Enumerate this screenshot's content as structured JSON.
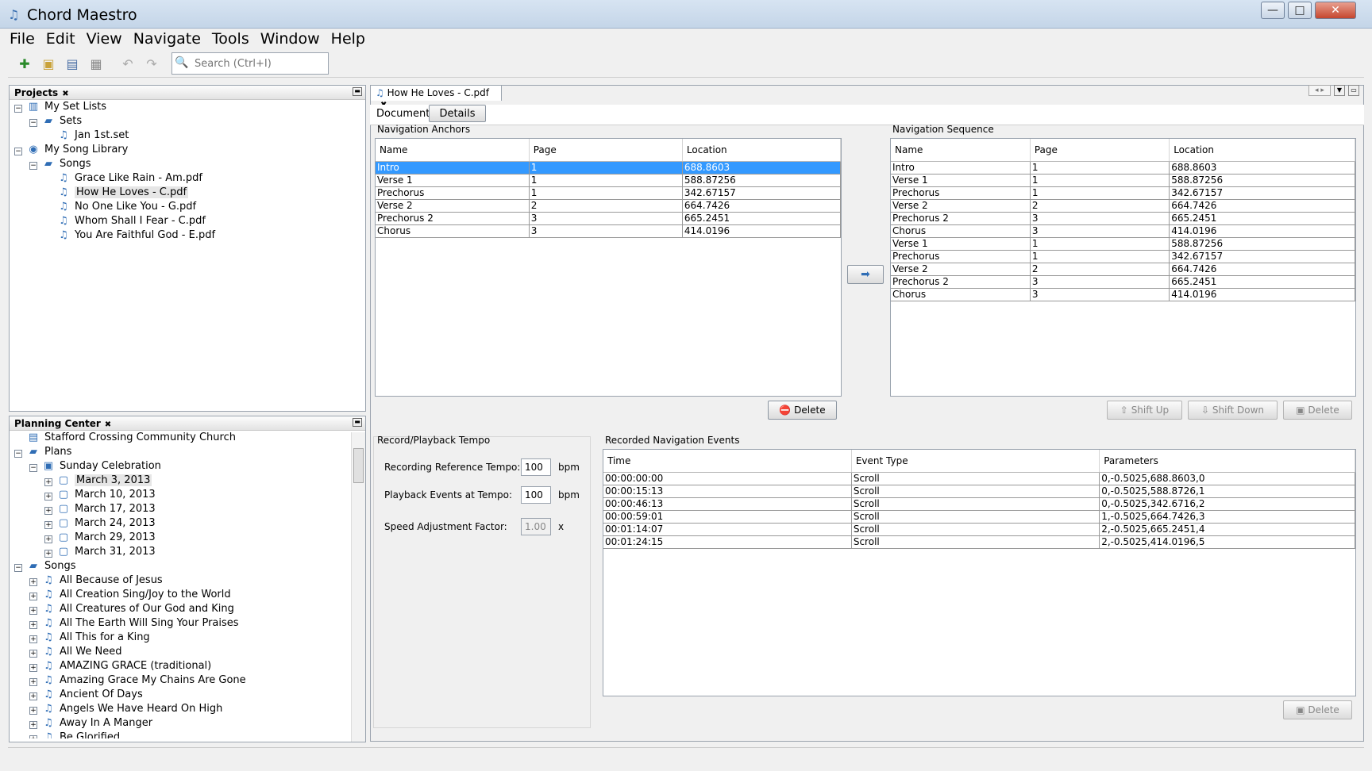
{
  "window": {
    "title": "Chord Maestro",
    "minimize": "—",
    "maximize": "□",
    "close": "✕"
  },
  "menu": [
    "File",
    "Edit",
    "View",
    "Navigate",
    "Tools",
    "Window",
    "Help"
  ],
  "toolbar": {
    "search_placeholder": "Search (Ctrl+I)"
  },
  "projects": {
    "header": "Projects",
    "items": [
      {
        "label": "My Set Lists",
        "level": 0,
        "exp": "−",
        "icon": "setlist-icon"
      },
      {
        "label": "Sets",
        "level": 1,
        "exp": "−",
        "icon": "folder-icon"
      },
      {
        "label": "Jan 1st.set",
        "level": 2,
        "exp": "",
        "icon": "set-file-icon"
      },
      {
        "label": "My Song Library",
        "level": 0,
        "exp": "−",
        "icon": "library-icon"
      },
      {
        "label": "Songs",
        "level": 1,
        "exp": "−",
        "icon": "folder-icon"
      },
      {
        "label": "Grace Like Rain - Am.pdf",
        "level": 2,
        "exp": "",
        "icon": "music-note-icon"
      },
      {
        "label": "How He Loves - C.pdf",
        "level": 2,
        "exp": "",
        "icon": "music-note-icon",
        "selected": true
      },
      {
        "label": "No One Like You - G.pdf",
        "level": 2,
        "exp": "",
        "icon": "music-note-icon"
      },
      {
        "label": "Whom Shall I Fear - C.pdf",
        "level": 2,
        "exp": "",
        "icon": "music-note-icon"
      },
      {
        "label": "You Are Faithful God - E.pdf",
        "level": 2,
        "exp": "",
        "icon": "music-note-icon"
      }
    ]
  },
  "planning": {
    "header": "Planning Center",
    "items": [
      {
        "label": "Stafford Crossing Community Church",
        "level": 0,
        "exp": "",
        "icon": "church-icon"
      },
      {
        "label": "Plans",
        "level": 0,
        "exp": "−",
        "icon": "folder-icon"
      },
      {
        "label": "Sunday Celebration",
        "level": 1,
        "exp": "−",
        "icon": "service-icon"
      },
      {
        "label": "March 3, 2013",
        "level": 2,
        "exp": "+",
        "icon": "plan-icon",
        "selected": true
      },
      {
        "label": "March 10, 2013",
        "level": 2,
        "exp": "+",
        "icon": "plan-icon"
      },
      {
        "label": "March 17, 2013",
        "level": 2,
        "exp": "+",
        "icon": "plan-icon"
      },
      {
        "label": "March 24, 2013",
        "level": 2,
        "exp": "+",
        "icon": "plan-icon"
      },
      {
        "label": "March 29, 2013",
        "level": 2,
        "exp": "+",
        "icon": "plan-icon"
      },
      {
        "label": "March 31, 2013",
        "level": 2,
        "exp": "+",
        "icon": "plan-icon"
      },
      {
        "label": "Songs",
        "level": 0,
        "exp": "−",
        "icon": "folder-icon"
      },
      {
        "label": "All Because of Jesus",
        "level": 1,
        "exp": "+",
        "icon": "song-icon"
      },
      {
        "label": "All Creation Sing/Joy to the World",
        "level": 1,
        "exp": "+",
        "icon": "song-icon"
      },
      {
        "label": "All Creatures of Our God and King",
        "level": 1,
        "exp": "+",
        "icon": "song-icon"
      },
      {
        "label": "All The Earth Will Sing Your Praises",
        "level": 1,
        "exp": "+",
        "icon": "song-icon"
      },
      {
        "label": "All This for a King",
        "level": 1,
        "exp": "+",
        "icon": "song-icon"
      },
      {
        "label": "All We Need",
        "level": 1,
        "exp": "+",
        "icon": "song-icon"
      },
      {
        "label": "AMAZING GRACE (traditional)",
        "level": 1,
        "exp": "+",
        "icon": "song-icon"
      },
      {
        "label": "Amazing Grace My Chains Are Gone",
        "level": 1,
        "exp": "+",
        "icon": "song-icon"
      },
      {
        "label": "Ancient Of Days",
        "level": 1,
        "exp": "+",
        "icon": "song-icon"
      },
      {
        "label": "Angels We Have Heard On High",
        "level": 1,
        "exp": "+",
        "icon": "song-icon"
      },
      {
        "label": "Away In A Manger",
        "level": 1,
        "exp": "+",
        "icon": "song-icon"
      },
      {
        "label": "Be Glorified",
        "level": 1,
        "exp": "+",
        "icon": "song-icon"
      }
    ]
  },
  "editor": {
    "tab_label": "How He Loves - C.pdf",
    "subtabs": {
      "document": "Document",
      "details": "Details"
    },
    "anchors": {
      "title": "Navigation Anchors",
      "columns": [
        "Name",
        "Page",
        "Location"
      ],
      "rows": [
        [
          "Intro",
          "1",
          "688.8603"
        ],
        [
          "Verse 1",
          "1",
          "588.87256"
        ],
        [
          "Prechorus",
          "1",
          "342.67157"
        ],
        [
          "Verse 2",
          "2",
          "664.7426"
        ],
        [
          "Prechorus 2",
          "3",
          "665.2451"
        ],
        [
          "Chorus",
          "3",
          "414.0196"
        ]
      ],
      "selected_row": 0,
      "delete_label": "Delete"
    },
    "add_arrow": "➡",
    "sequence": {
      "title": "Navigation Sequence",
      "columns": [
        "Name",
        "Page",
        "Location"
      ],
      "rows": [
        [
          "Intro",
          "1",
          "688.8603"
        ],
        [
          "Verse 1",
          "1",
          "588.87256"
        ],
        [
          "Prechorus",
          "1",
          "342.67157"
        ],
        [
          "Verse 2",
          "2",
          "664.7426"
        ],
        [
          "Prechorus 2",
          "3",
          "665.2451"
        ],
        [
          "Chorus",
          "3",
          "414.0196"
        ],
        [
          "Verse 1",
          "1",
          "588.87256"
        ],
        [
          "Prechorus",
          "1",
          "342.67157"
        ],
        [
          "Verse 2",
          "2",
          "664.7426"
        ],
        [
          "Prechorus 2",
          "3",
          "665.2451"
        ],
        [
          "Chorus",
          "3",
          "414.0196"
        ]
      ],
      "shift_up": "Shift Up",
      "shift_down": "Shift Down",
      "delete_label": "Delete"
    },
    "tempo": {
      "title": "Record/Playback Tempo",
      "rec_label": "Recording Reference Tempo:",
      "rec_value": "100",
      "rec_unit": "bpm",
      "play_label": "Playback Events at Tempo:",
      "play_value": "100",
      "play_unit": "bpm",
      "speed_label": "Speed Adjustment Factor:",
      "speed_value": "1.00",
      "speed_unit": "x"
    },
    "events": {
      "title": "Recorded Navigation Events",
      "columns": [
        "Time",
        "Event Type",
        "Parameters"
      ],
      "rows": [
        [
          "00:00:00:00",
          "Scroll",
          "0,-0.5025,688.8603,0"
        ],
        [
          "00:00:15:13",
          "Scroll",
          "0,-0.5025,588.8726,1"
        ],
        [
          "00:00:46:13",
          "Scroll",
          "0,-0.5025,342.6716,2"
        ],
        [
          "00:00:59:01",
          "Scroll",
          "1,-0.5025,664.7426,3"
        ],
        [
          "00:01:14:07",
          "Scroll",
          "2,-0.5025,665.2451,4"
        ],
        [
          "00:01:24:15",
          "Scroll",
          "2,-0.5025,414.0196,5"
        ]
      ],
      "delete_label": "Delete"
    }
  }
}
